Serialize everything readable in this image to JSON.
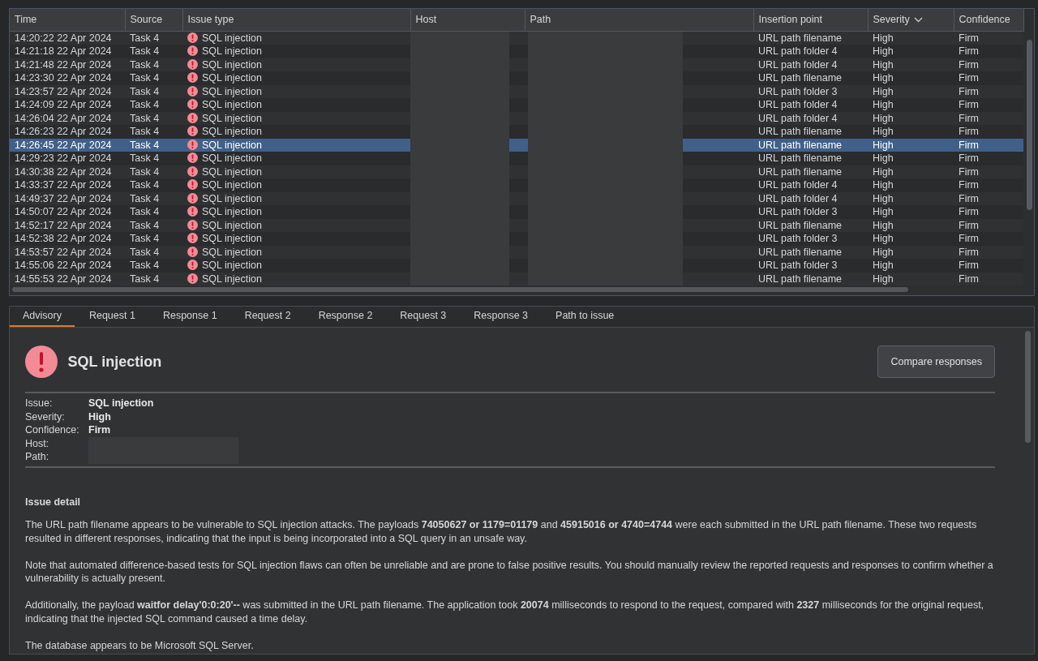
{
  "table": {
    "columns": [
      {
        "label": "Time",
        "sorted": false
      },
      {
        "label": "Source",
        "sorted": false
      },
      {
        "label": "Issue type",
        "sorted": false
      },
      {
        "label": "Host",
        "sorted": false
      },
      {
        "label": "Path",
        "sorted": false
      },
      {
        "label": "Insertion point",
        "sorted": false
      },
      {
        "label": "Severity",
        "sorted": true
      },
      {
        "label": "Confidence",
        "sorted": false
      }
    ],
    "rows": [
      {
        "time": "14:20:22 22 Apr 2024",
        "source": "Task 4",
        "issue_type": "SQL injection",
        "insertion_point": "URL path filename",
        "severity": "High",
        "confidence": "Firm",
        "selected": false
      },
      {
        "time": "14:21:18 22 Apr 2024",
        "source": "Task 4",
        "issue_type": "SQL injection",
        "insertion_point": "URL path folder 4",
        "severity": "High",
        "confidence": "Firm",
        "selected": false
      },
      {
        "time": "14:21:48 22 Apr 2024",
        "source": "Task 4",
        "issue_type": "SQL injection",
        "insertion_point": "URL path folder 4",
        "severity": "High",
        "confidence": "Firm",
        "selected": false
      },
      {
        "time": "14:23:30 22 Apr 2024",
        "source": "Task 4",
        "issue_type": "SQL injection",
        "insertion_point": "URL path filename",
        "severity": "High",
        "confidence": "Firm",
        "selected": false
      },
      {
        "time": "14:23:57 22 Apr 2024",
        "source": "Task 4",
        "issue_type": "SQL injection",
        "insertion_point": "URL path folder 3",
        "severity": "High",
        "confidence": "Firm",
        "selected": false
      },
      {
        "time": "14:24:09 22 Apr 2024",
        "source": "Task 4",
        "issue_type": "SQL injection",
        "insertion_point": "URL path folder 4",
        "severity": "High",
        "confidence": "Firm",
        "selected": false
      },
      {
        "time": "14:26:04 22 Apr 2024",
        "source": "Task 4",
        "issue_type": "SQL injection",
        "insertion_point": "URL path folder 4",
        "severity": "High",
        "confidence": "Firm",
        "selected": false
      },
      {
        "time": "14:26:23 22 Apr 2024",
        "source": "Task 4",
        "issue_type": "SQL injection",
        "insertion_point": "URL path filename",
        "severity": "High",
        "confidence": "Firm",
        "selected": false
      },
      {
        "time": "14:26:45 22 Apr 2024",
        "source": "Task 4",
        "issue_type": "SQL injection",
        "insertion_point": "URL path filename",
        "severity": "High",
        "confidence": "Firm",
        "selected": true
      },
      {
        "time": "14:29:23 22 Apr 2024",
        "source": "Task 4",
        "issue_type": "SQL injection",
        "insertion_point": "URL path filename",
        "severity": "High",
        "confidence": "Firm",
        "selected": false
      },
      {
        "time": "14:30:38 22 Apr 2024",
        "source": "Task 4",
        "issue_type": "SQL injection",
        "insertion_point": "URL path filename",
        "severity": "High",
        "confidence": "Firm",
        "selected": false
      },
      {
        "time": "14:33:37 22 Apr 2024",
        "source": "Task 4",
        "issue_type": "SQL injection",
        "insertion_point": "URL path folder 4",
        "severity": "High",
        "confidence": "Firm",
        "selected": false
      },
      {
        "time": "14:49:37 22 Apr 2024",
        "source": "Task 4",
        "issue_type": "SQL injection",
        "insertion_point": "URL path folder 4",
        "severity": "High",
        "confidence": "Firm",
        "selected": false
      },
      {
        "time": "14:50:07 22 Apr 2024",
        "source": "Task 4",
        "issue_type": "SQL injection",
        "insertion_point": "URL path folder 3",
        "severity": "High",
        "confidence": "Firm",
        "selected": false
      },
      {
        "time": "14:52:17 22 Apr 2024",
        "source": "Task 4",
        "issue_type": "SQL injection",
        "insertion_point": "URL path filename",
        "severity": "High",
        "confidence": "Firm",
        "selected": false
      },
      {
        "time": "14:52:38 22 Apr 2024",
        "source": "Task 4",
        "issue_type": "SQL injection",
        "insertion_point": "URL path folder 3",
        "severity": "High",
        "confidence": "Firm",
        "selected": false
      },
      {
        "time": "14:53:57 22 Apr 2024",
        "source": "Task 4",
        "issue_type": "SQL injection",
        "insertion_point": "URL path filename",
        "severity": "High",
        "confidence": "Firm",
        "selected": false
      },
      {
        "time": "14:55:06 22 Apr 2024",
        "source": "Task 4",
        "issue_type": "SQL injection",
        "insertion_point": "URL path folder 3",
        "severity": "High",
        "confidence": "Firm",
        "selected": false
      },
      {
        "time": "14:55:53 22 Apr 2024",
        "source": "Task 4",
        "issue_type": "SQL injection",
        "insertion_point": "URL path filename",
        "severity": "High",
        "confidence": "Firm",
        "selected": false
      }
    ]
  },
  "tabs": [
    {
      "label": "Advisory",
      "selected": true
    },
    {
      "label": "Request 1",
      "selected": false
    },
    {
      "label": "Response 1",
      "selected": false
    },
    {
      "label": "Request 2",
      "selected": false
    },
    {
      "label": "Response 2",
      "selected": false
    },
    {
      "label": "Request 3",
      "selected": false
    },
    {
      "label": "Response 3",
      "selected": false
    },
    {
      "label": "Path to issue",
      "selected": false
    }
  ],
  "advisory": {
    "title": "SQL injection",
    "compare_button": "Compare responses",
    "fields": [
      {
        "label": "Issue:",
        "value": "SQL injection"
      },
      {
        "label": "Severity:",
        "value": "High"
      },
      {
        "label": "Confidence:",
        "value": "Firm"
      },
      {
        "label": "Host:",
        "redacted": true
      },
      {
        "label": "Path:",
        "redacted": true
      }
    ],
    "detail_heading": "Issue detail",
    "paragraphs": [
      "The URL path filename appears to be vulnerable to SQL injection attacks. The payloads **74050627 or 1179=01179** and **45915016 or 4740=4744** were each submitted in the URL path filename. These two requests resulted in different responses, indicating that the input is being incorporated into a SQL query in an unsafe way.",
      "Note that automated difference-based tests for SQL injection flaws can often be unreliable and are prone to false positive results. You should manually review the reported requests and responses to confirm whether a vulnerability is actually present.",
      "Additionally, the payload **waitfor delay'0:0:20'--** was submitted in the URL path filename. The application took **20074** milliseconds to respond to the request, compared with **2327** milliseconds for the original request, indicating that the injected SQL command caused a time delay.",
      "The database appears to be Microsoft SQL Server."
    ]
  }
}
